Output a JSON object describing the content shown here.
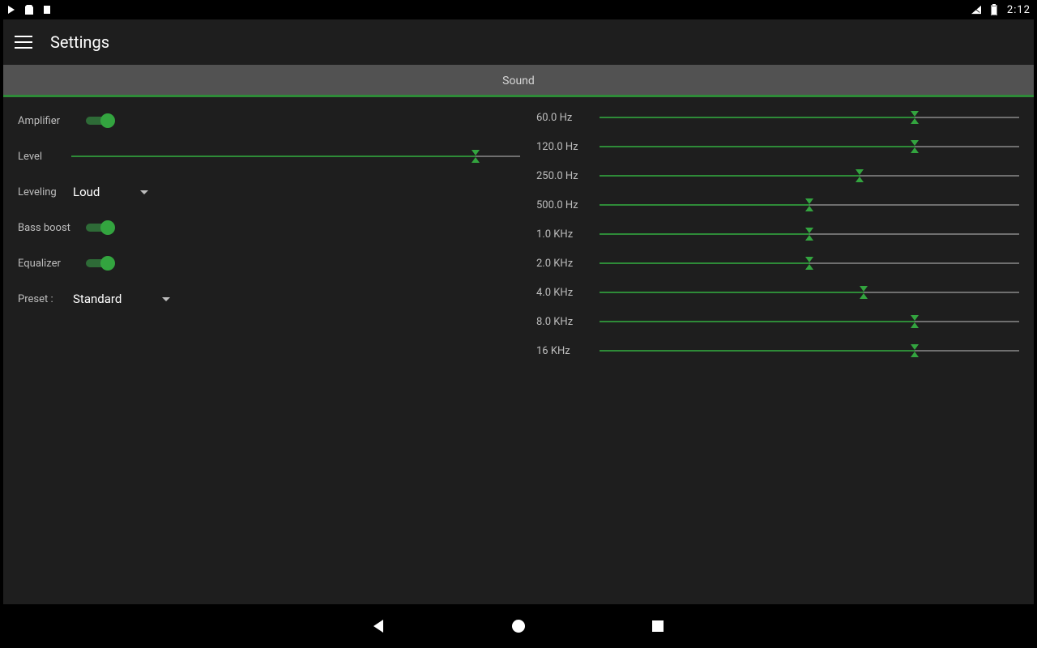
{
  "status": {
    "clock": "2:12"
  },
  "header": {
    "title": "Settings"
  },
  "tab": {
    "label": "Sound"
  },
  "left": {
    "amplifier_label": "Amplifier",
    "amplifier_on": true,
    "level_label": "Level",
    "level_percent": 90,
    "leveling_label": "Leveling",
    "leveling_value": "Loud",
    "bassboost_label": "Bass boost",
    "bassboost_on": true,
    "equalizer_label": "Equalizer",
    "equalizer_on": true,
    "preset_label": "Preset :",
    "preset_value": "Standard"
  },
  "eq": {
    "bands": [
      {
        "label": "60.0 Hz",
        "percent": 75
      },
      {
        "label": "120.0 Hz",
        "percent": 75
      },
      {
        "label": "250.0 Hz",
        "percent": 62
      },
      {
        "label": "500.0 Hz",
        "percent": 50
      },
      {
        "label": "1.0 KHz",
        "percent": 50
      },
      {
        "label": "2.0 KHz",
        "percent": 50
      },
      {
        "label": "4.0 KHz",
        "percent": 63
      },
      {
        "label": "8.0 KHz",
        "percent": 75
      },
      {
        "label": "16 KHz",
        "percent": 75
      }
    ]
  }
}
